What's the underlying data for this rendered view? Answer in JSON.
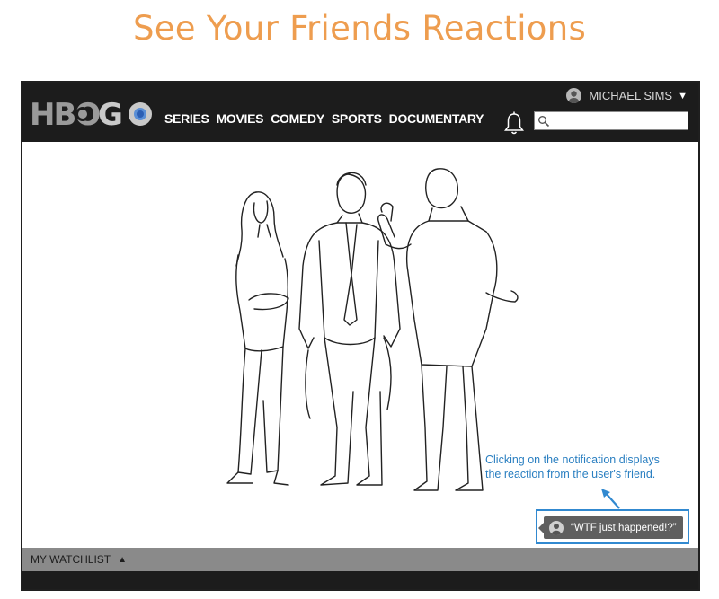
{
  "page": {
    "title": "See Your Friends Reactions"
  },
  "header": {
    "logo_text": "HBO GO",
    "nav": [
      "SERIES",
      "MOVIES",
      "COMEDY",
      "SPORTS",
      "DOCUMENTARY"
    ],
    "user_name": "MICHAEL SIMS",
    "search_placeholder": ""
  },
  "annotation": {
    "text_line1": "Clicking on the notification displays",
    "text_line2": "the reaction from the user's friend."
  },
  "notification": {
    "text": "“WTF just happened!?”"
  },
  "footer": {
    "watchlist_label": "MY WATCHLIST"
  },
  "colors": {
    "title": "#ee9d4f",
    "accent": "#3189d0",
    "bar": "#1c1c1c"
  },
  "icons": [
    "bell-icon",
    "search-icon",
    "user-avatar-icon",
    "caret-down-icon",
    "caret-up-icon",
    "arrow-icon"
  ]
}
